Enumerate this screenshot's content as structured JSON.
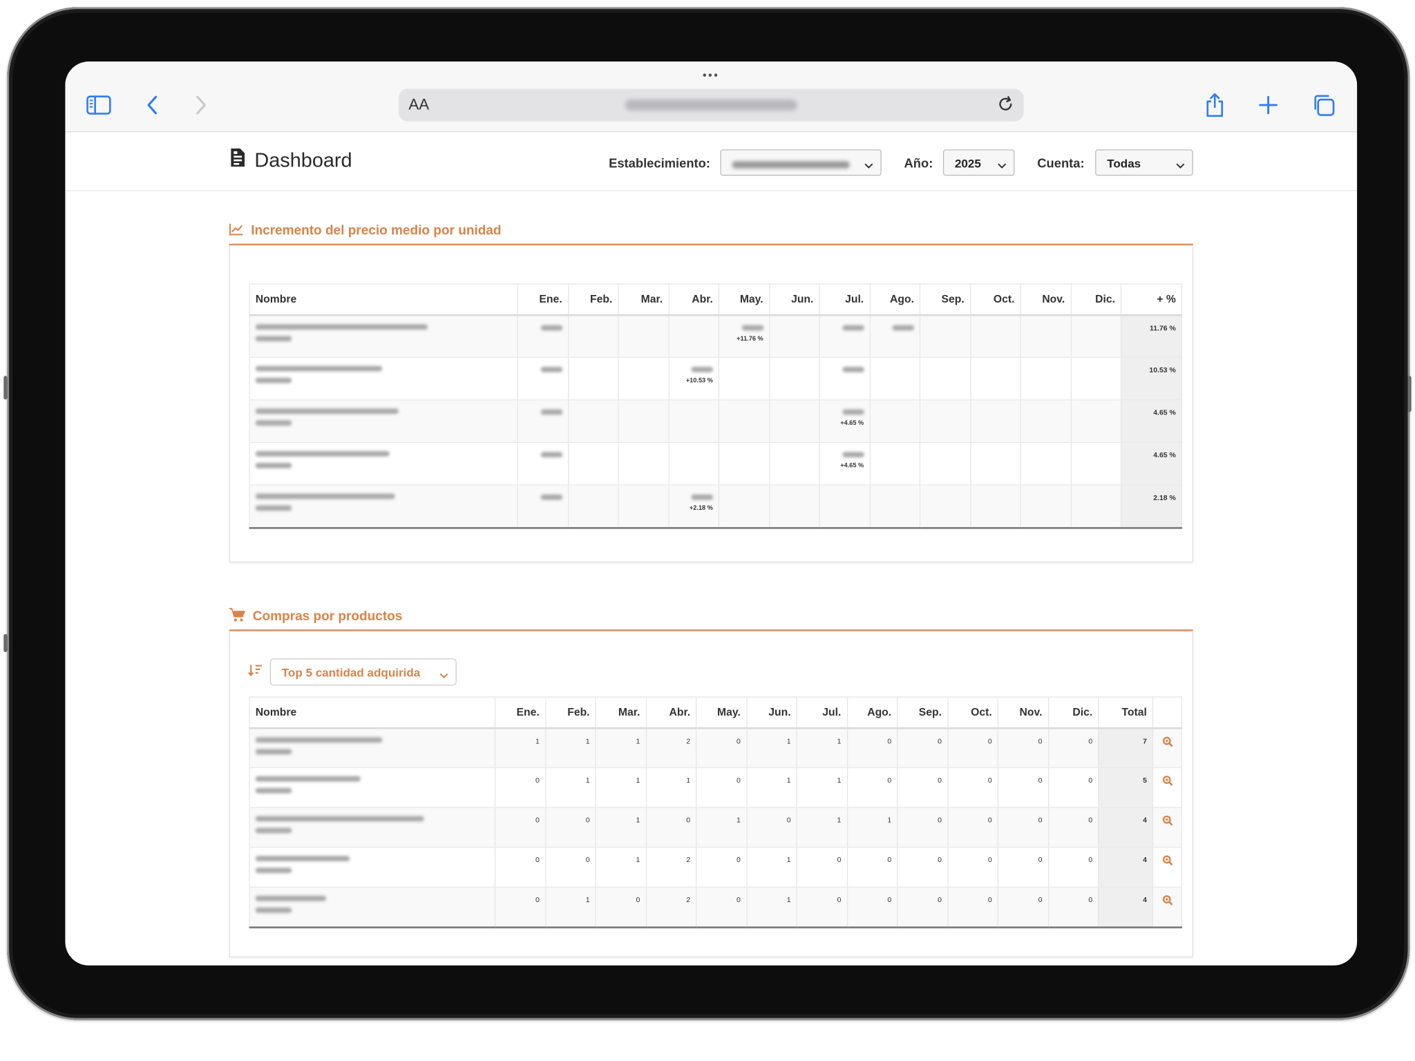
{
  "browser": {
    "aa_label": "AA"
  },
  "header": {
    "title": "Dashboard",
    "filters": {
      "establecimiento_label": "Establecimiento:",
      "anio_label": "Año:",
      "anio_value": "2025",
      "cuenta_label": "Cuenta:",
      "cuenta_value": "Todas"
    }
  },
  "section1": {
    "title": "Incremento del precio medio por unidad",
    "columns": [
      "Nombre",
      "Ene.",
      "Feb.",
      "Mar.",
      "Abr.",
      "May.",
      "Jun.",
      "Jul.",
      "Ago.",
      "Sep.",
      "Oct.",
      "Nov.",
      "Dic.",
      "+ %"
    ],
    "rows": [
      {
        "total": "11.76 %",
        "change_month": "May.",
        "change": "+11.76 %"
      },
      {
        "total": "10.53 %",
        "change_month": "Abr.",
        "change": "+10.53 %"
      },
      {
        "total": "4.65 %",
        "change_month": "Jul.",
        "change": "+4.65 %"
      },
      {
        "total": "4.65 %",
        "change_month": "Jul.",
        "change": "+4.65 %"
      },
      {
        "total": "2.18 %",
        "change_month": "Abr.",
        "change": "+2.18 %"
      }
    ]
  },
  "section2": {
    "title": "Compras por productos",
    "sort_value": "Top 5 cantidad adquirida",
    "columns": [
      "Nombre",
      "Ene.",
      "Feb.",
      "Mar.",
      "Abr.",
      "May.",
      "Jun.",
      "Jul.",
      "Ago.",
      "Sep.",
      "Oct.",
      "Nov.",
      "Dic.",
      "Total",
      ""
    ],
    "rows": [
      {
        "values": [
          "1",
          "1",
          "1",
          "2",
          "0",
          "1",
          "1",
          "0",
          "0",
          "0",
          "0",
          "0"
        ],
        "total": "7"
      },
      {
        "values": [
          "0",
          "1",
          "1",
          "1",
          "0",
          "1",
          "1",
          "0",
          "0",
          "0",
          "0",
          "0"
        ],
        "total": "5"
      },
      {
        "values": [
          "0",
          "0",
          "1",
          "0",
          "1",
          "0",
          "1",
          "1",
          "0",
          "0",
          "0",
          "0"
        ],
        "total": "4"
      },
      {
        "values": [
          "0",
          "0",
          "1",
          "2",
          "0",
          "1",
          "0",
          "0",
          "0",
          "0",
          "0",
          "0"
        ],
        "total": "4"
      },
      {
        "values": [
          "0",
          "1",
          "0",
          "2",
          "0",
          "1",
          "0",
          "0",
          "0",
          "0",
          "0",
          "0"
        ],
        "total": "4"
      }
    ]
  },
  "colors": {
    "accent": "#d9834a",
    "link_blue": "#2f7cf6"
  },
  "icons": [
    "sidebar-icon",
    "back-icon",
    "forward-icon",
    "reload-icon",
    "share-icon",
    "plus-icon",
    "tabs-icon",
    "document-icon",
    "chart-line-icon",
    "cart-icon",
    "sort-icon",
    "chevron-down-icon",
    "zoom-icon"
  ]
}
